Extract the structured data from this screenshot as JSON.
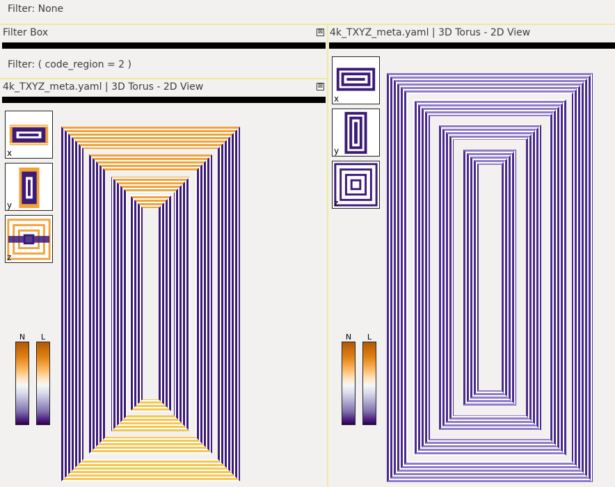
{
  "filters": {
    "top_filter": "Filter: None",
    "region_filter": "Filter: ( code_region = 2 )"
  },
  "filter_box": {
    "title": "Filter Box",
    "close_label": "⊠"
  },
  "left_view": {
    "title": "4k_TXYZ_meta.yaml  |  3D Torus - 2D View",
    "close_label": "⊠",
    "thumbnails": [
      {
        "axis": "x"
      },
      {
        "axis": "y"
      },
      {
        "axis": "z"
      }
    ],
    "legend": {
      "n_label": "N",
      "l_label": "L"
    }
  },
  "right_view": {
    "title": "4k_TXYZ_meta.yaml  |  3D Torus - 2D View",
    "thumbnails": [
      {
        "axis": "x"
      },
      {
        "axis": "y"
      },
      {
        "axis": "z"
      }
    ],
    "legend": {
      "n_label": "N",
      "l_label": "L"
    }
  },
  "colors": {
    "panel_divider": "#eeeb9a",
    "node_dark": "#3b1a78",
    "node_mid": "#6a4fb0",
    "node_light": "#b8a8e0",
    "hot_orange": "#f29a2e",
    "hot_yellow": "#f9d35a"
  }
}
